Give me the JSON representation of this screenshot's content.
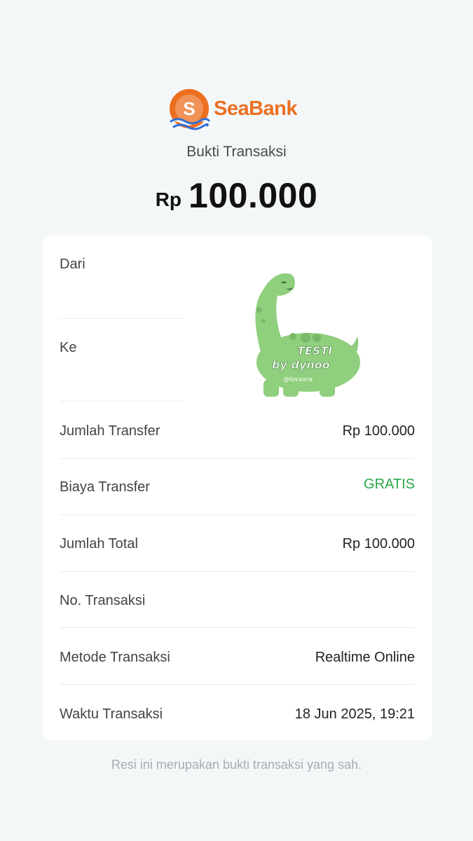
{
  "brand": {
    "name": "SeaBank",
    "mark_letter": "S",
    "color": "#ec6f20",
    "wave_color": "#2f6fd8"
  },
  "receipt": {
    "title": "Bukti Transaksi",
    "currency": "Rp",
    "amount": "100.000"
  },
  "details": {
    "from_label": "Dari",
    "to_label": "Ke",
    "rows": [
      {
        "label": "Jumlah Transfer",
        "value": "Rp 100.000"
      },
      {
        "label": "Biaya Transfer",
        "value": "GRATIS"
      },
      {
        "label": "Jumlah Total",
        "value": "Rp 100.000"
      },
      {
        "label": "No. Transaksi",
        "value": ""
      },
      {
        "label": "Metode Transaksi",
        "value": "Realtime Online"
      },
      {
        "label": "Waktu Transaksi",
        "value": "18 Jun 2025, 19:21"
      }
    ]
  },
  "sticker": {
    "line1": "TESTI",
    "line2": "by dynoo",
    "handle": "@lovxxra",
    "icon": "green-dinosaur-sticker"
  },
  "footer": {
    "note": "Resi ini merupakan bukti transaksi yang sah."
  }
}
